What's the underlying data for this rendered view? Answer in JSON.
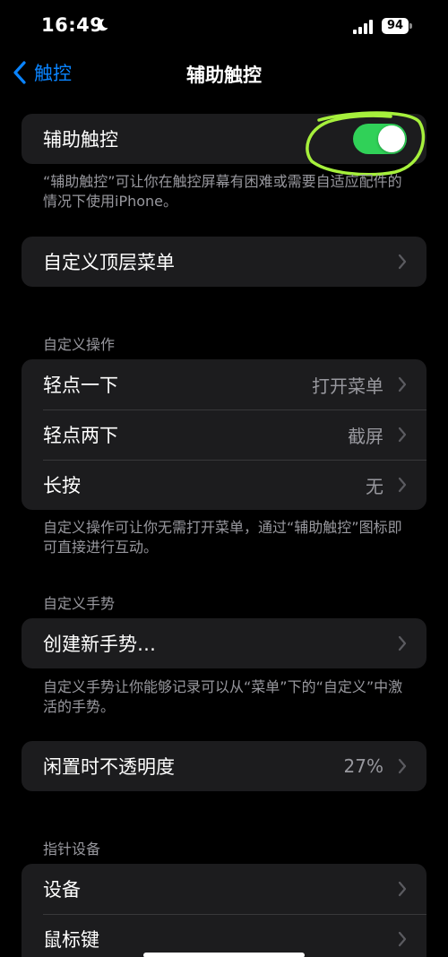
{
  "status_bar": {
    "time": "16:49",
    "battery": "94",
    "icons": [
      "moon-icon",
      "cellular-signal-icon",
      "wifi-icon",
      "battery-icon"
    ]
  },
  "nav": {
    "back_label": "触控",
    "title": "辅助触控"
  },
  "main_toggle": {
    "label": "辅助触控",
    "state": "on",
    "caption": "“辅助触控”可让你在触控屏幕有困难或需要自适应配件的情况下使用iPhone。"
  },
  "top_menu": {
    "label": "自定义顶层菜单"
  },
  "custom_actions": {
    "header": "自定义操作",
    "rows": [
      {
        "label": "轻点一下",
        "value": "打开菜单"
      },
      {
        "label": "轻点两下",
        "value": "截屏"
      },
      {
        "label": "长按",
        "value": "无"
      }
    ],
    "caption": "自定义操作可让你无需打开菜单，通过“辅助触控”图标即可直接进行互动。"
  },
  "custom_gestures": {
    "header": "自定义手势",
    "create_label": "创建新手势…",
    "caption": "自定义手势让你能够记录可以从“菜单”下的“自定义”中激活的手势。"
  },
  "idle_opacity": {
    "label": "闲置时不透明度",
    "value": "27%"
  },
  "pointer_devices": {
    "header": "指针设备",
    "rows": [
      {
        "label": "设备"
      },
      {
        "label": "鼠标键"
      }
    ]
  },
  "colors": {
    "accent": "#0a84ff",
    "toggle_on": "#30d158",
    "annotation": "#a6f03c"
  }
}
